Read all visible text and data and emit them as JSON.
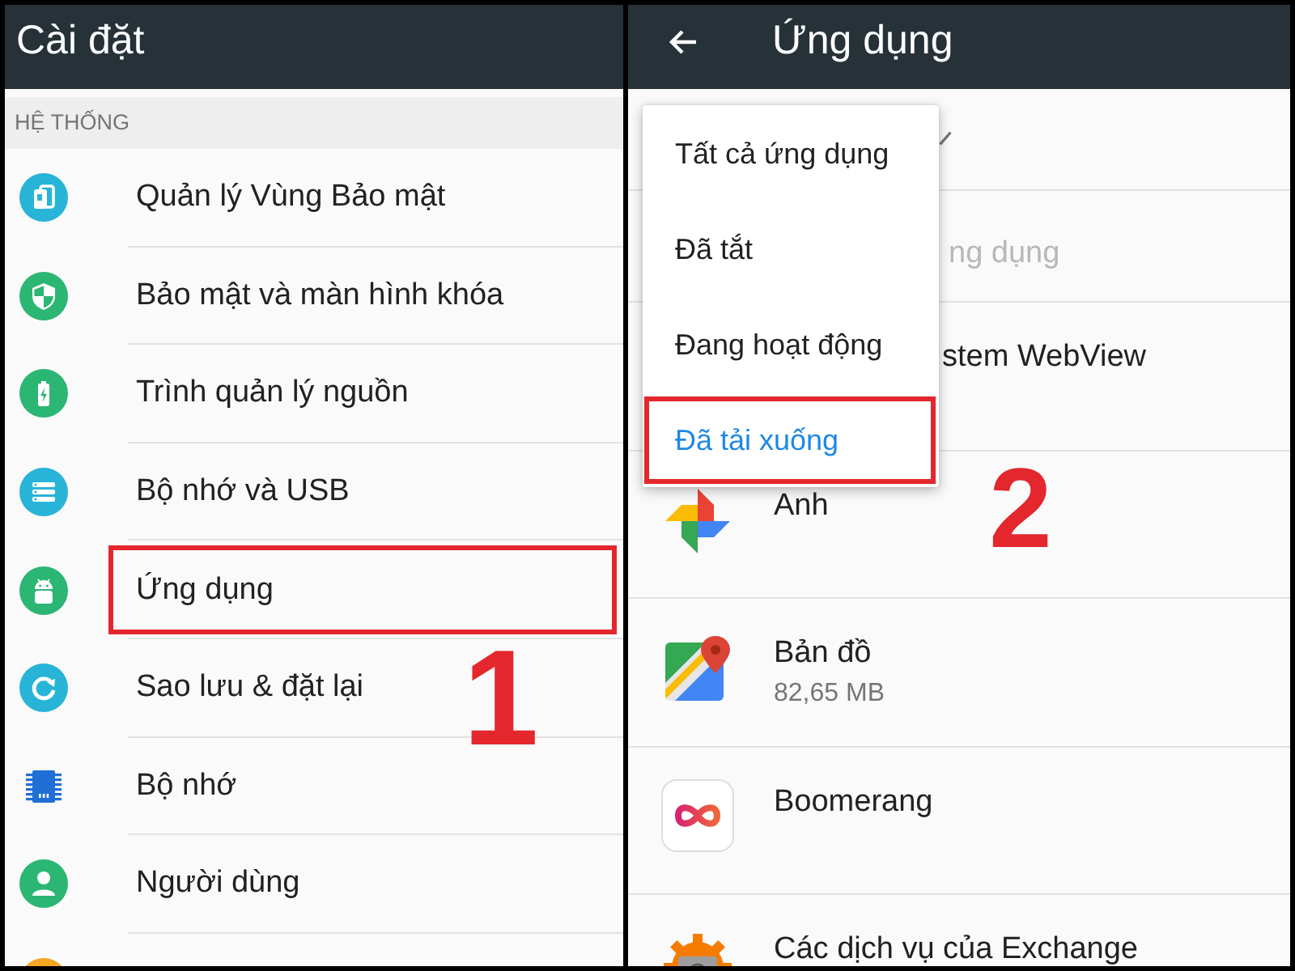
{
  "settings": {
    "title": "Cài đặt",
    "section_header": "HỆ THỐNG",
    "items": [
      {
        "label": "Quản lý Vùng Bảo mật",
        "highlighted": false
      },
      {
        "label": "Bảo mật và màn hình khóa",
        "highlighted": false
      },
      {
        "label": "Trình quản lý nguồn",
        "highlighted": false
      },
      {
        "label": "Bộ nhớ và USB",
        "highlighted": false
      },
      {
        "label": "Ứng dụng",
        "highlighted": true
      },
      {
        "label": "Sao lưu & đặt lại",
        "highlighted": false
      },
      {
        "label": "Bộ nhớ",
        "highlighted": false
      },
      {
        "label": "Người dùng",
        "highlighted": false
      }
    ],
    "step_number": "1"
  },
  "apps": {
    "title": "Ứng dụng",
    "rows": [
      {
        "kind": "spinner"
      },
      {
        "kind": "hint",
        "label": "ng dụng"
      },
      {
        "kind": "covered",
        "name": "stem WebView"
      },
      {
        "kind": "app",
        "name": "Anh"
      },
      {
        "kind": "app",
        "name": "Bản đồ",
        "size": "82,65 MB"
      },
      {
        "kind": "app",
        "name": "Boomerang"
      },
      {
        "kind": "app",
        "name": "Các dịch vụ của Exchange"
      }
    ],
    "menu": {
      "items": [
        {
          "label": "Tất cả ứng dụng",
          "selected": false,
          "highlighted": false
        },
        {
          "label": "Đã tắt",
          "selected": false,
          "highlighted": false
        },
        {
          "label": "Đang hoạt động",
          "selected": false,
          "highlighted": false
        },
        {
          "label": "Đã tải xuống",
          "selected": true,
          "highlighted": true
        }
      ]
    },
    "step_number": "2"
  }
}
